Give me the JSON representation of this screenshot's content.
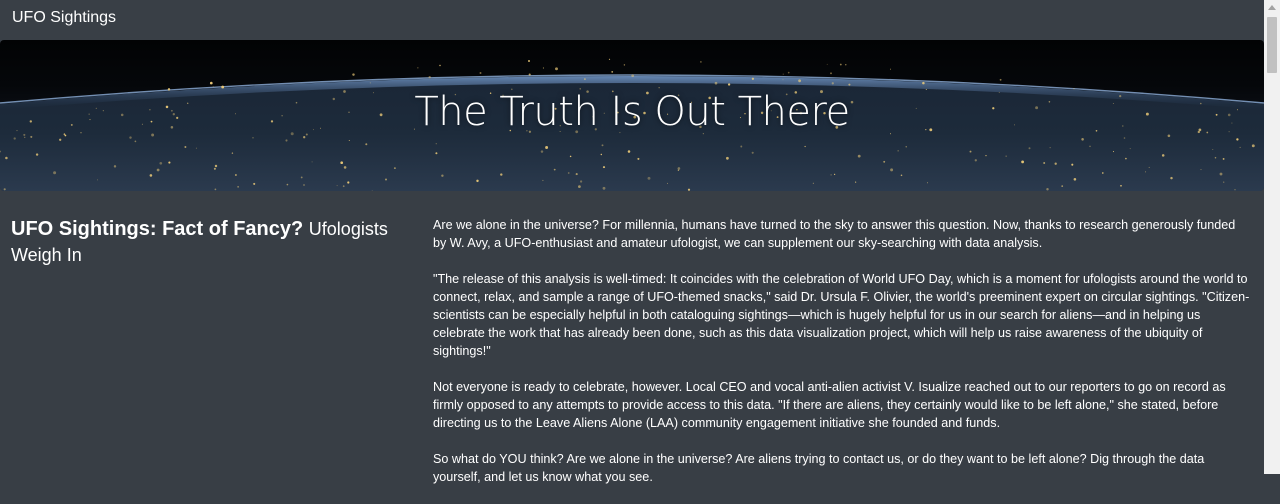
{
  "navbar": {
    "brand": "UFO Sightings"
  },
  "hero": {
    "title": "The Truth Is Out There"
  },
  "article": {
    "heading_main": "UFO Sightings: Fact of Fancy?",
    "heading_sub": "Ufologists Weigh In",
    "paragraphs": [
      "Are we alone in the universe? For millennia, humans have turned to the sky to answer this question. Now, thanks to research generously funded by W. Avy, a UFO-enthusiast and amateur ufologist, we can supplement our sky-searching with data analysis.",
      "\"The release of this analysis is well-timed: It coincides with the celebration of World UFO Day, which is a moment for ufologists around the world to connect, relax, and sample a range of UFO-themed snacks,\" said Dr. Ursula F. Olivier, the world's preeminent expert on circular sightings. \"Citizen-scientists can be especially helpful in both cataloguing sightings—which is hugely helpful for us in our search for aliens—and in helping us celebrate the work that has already been done, such as this data visualization project, which will help us raise awareness of the ubiquity of sightings!\"",
      "Not everyone is ready to celebrate, however. Local CEO and vocal anti-alien activist V. Isualize reached out to our reporters to go on record as firmly opposed to any attempts to provide access to this data. \"If there are aliens, they certainly would like to be left alone,\" she stated, before directing us to the Leave Aliens Alone (LAA) community engagement initiative she founded and funds.",
      "So what do YOU think? Are we alone in the universe? Are aliens trying to contact us, or do they want to be left alone? Dig through the data yourself, and let us know what you see."
    ]
  }
}
